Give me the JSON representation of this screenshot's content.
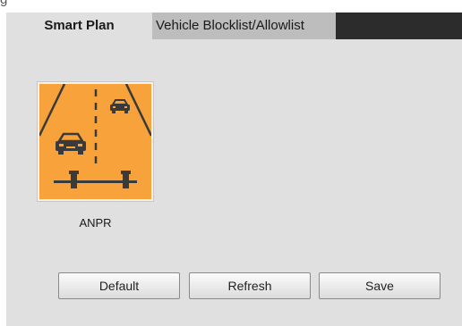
{
  "tabs": [
    {
      "label": "Smart Plan",
      "active": true
    },
    {
      "label": "Vehicle Blocklist/Allowlist",
      "active": false
    }
  ],
  "plans": [
    {
      "label": "ANPR",
      "icon": "anpr-road-camera-icon",
      "icon_bg": "#f7a23a"
    }
  ],
  "buttons": {
    "default_label": "Default",
    "refresh_label": "Refresh",
    "save_label": "Save"
  },
  "colors": {
    "tab_bar": "#2c2c2c",
    "panel": "#e0e0e0",
    "accent_orange": "#f7a23a"
  }
}
